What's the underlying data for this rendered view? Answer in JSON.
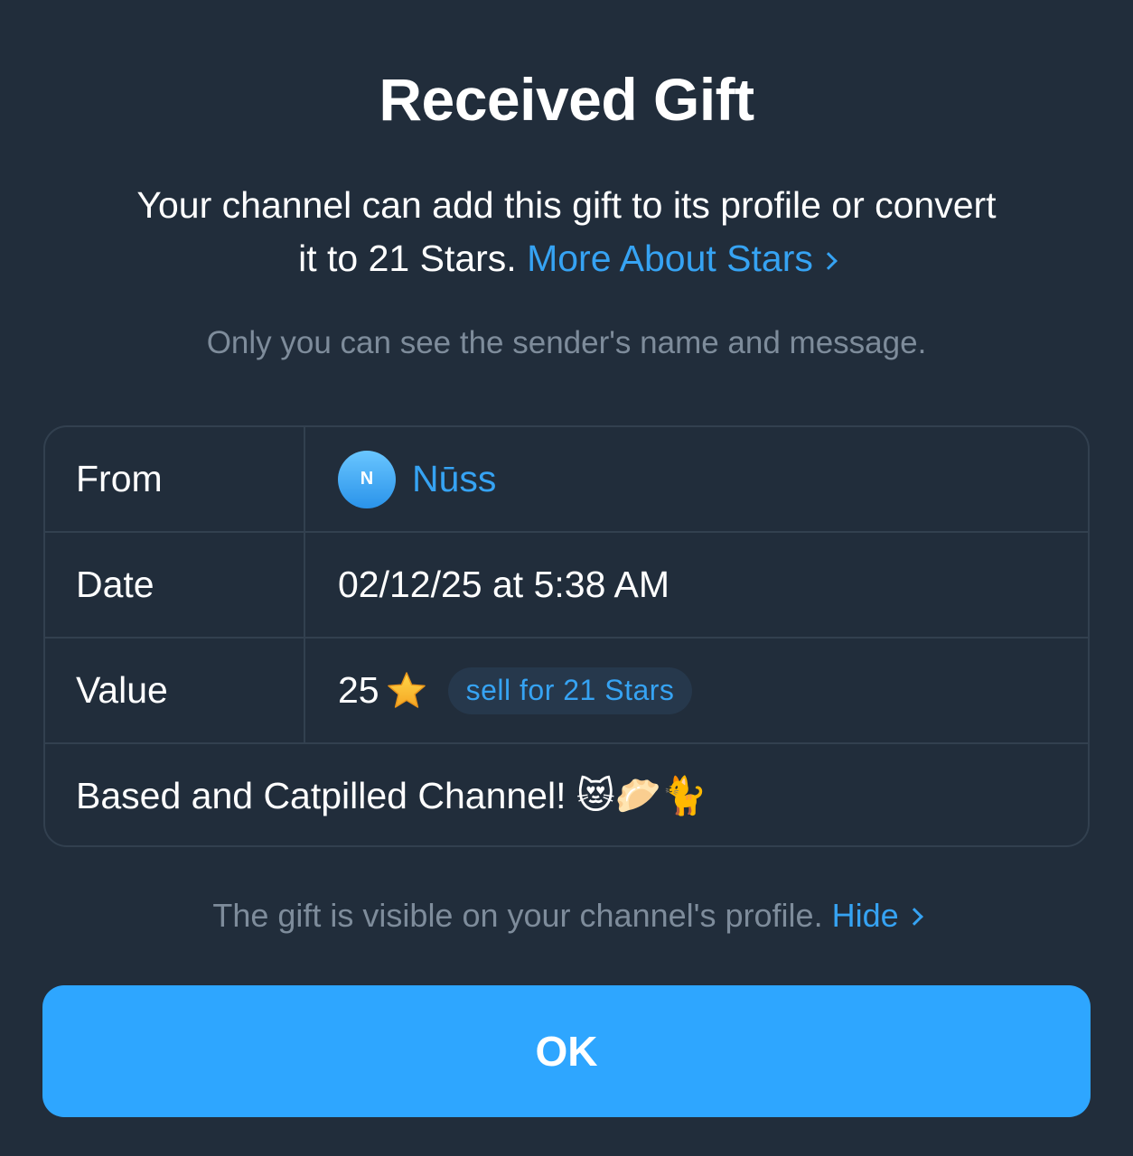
{
  "dialog": {
    "title": "Received Gift",
    "description": "Your channel can add this gift to its profile or convert it to 21 Stars.",
    "description_link": "More About Stars",
    "privacy_note": "Only you can see the sender's name and message."
  },
  "details": {
    "from_label": "From",
    "sender_initial": "N",
    "sender_name": "Nūss",
    "date_label": "Date",
    "date_value": "02/12/25 at 5:38 AM",
    "value_label": "Value",
    "value_amount": "25",
    "value_icon": "star-icon",
    "sell_label": "sell for 21 Stars",
    "message": "Based and Catpilled Channel! 😻🥟🐈"
  },
  "footer": {
    "visibility_note": "The gift is visible on your channel's profile.",
    "hide_link": "Hide",
    "ok_label": "OK"
  },
  "colors": {
    "background": "#212d3b",
    "accent": "#2ea6ff",
    "link": "#36a3f3",
    "muted": "#7e8c9b",
    "border": "#32404f"
  }
}
